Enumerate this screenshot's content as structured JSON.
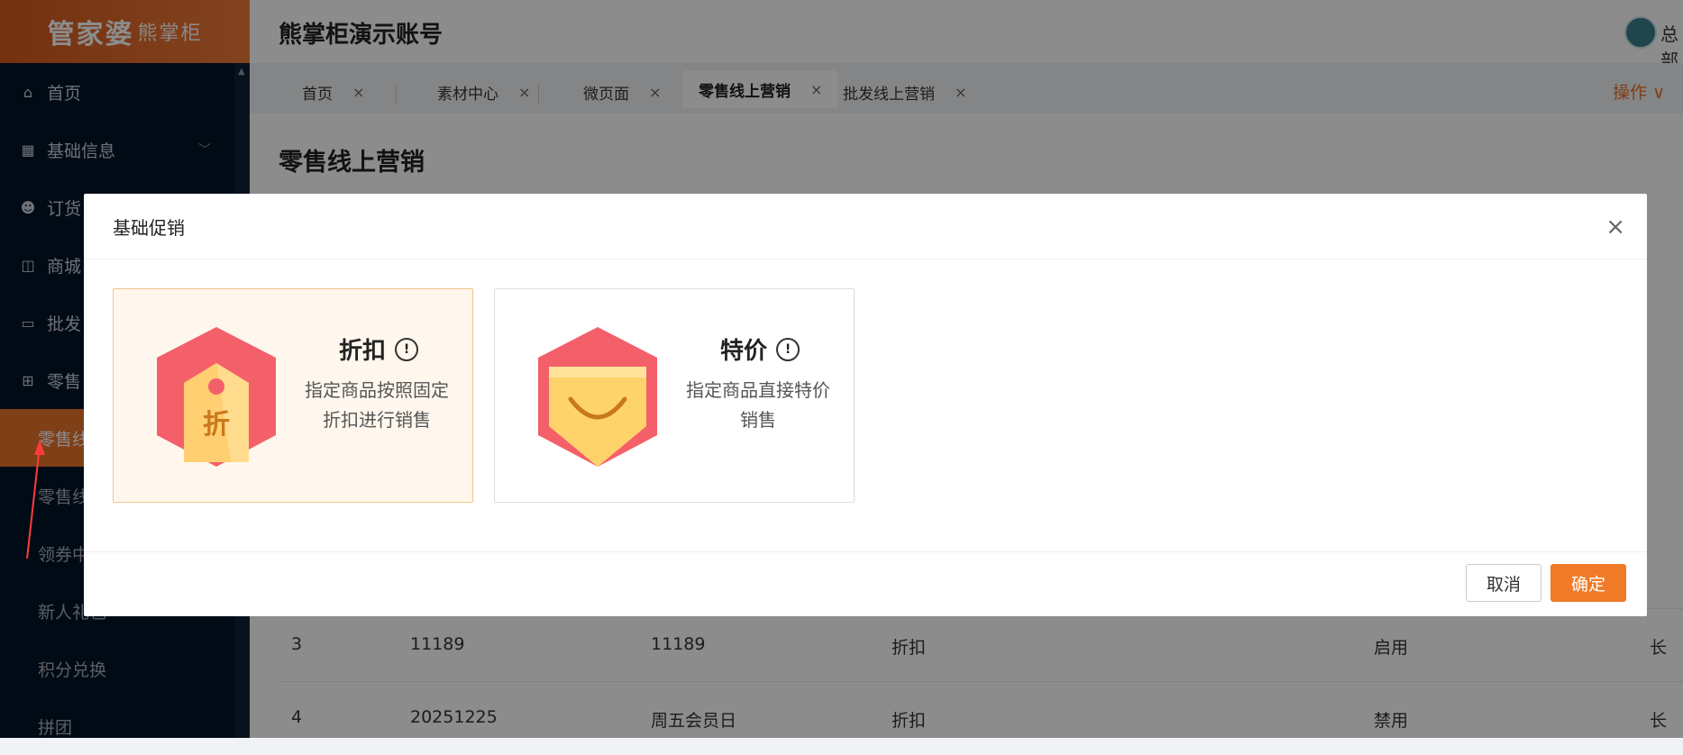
{
  "brand": {
    "logo": "管家婆",
    "logo_sub": "熊掌柜"
  },
  "header": {
    "account": "熊掌柜演示账号",
    "user": "总部"
  },
  "sidebar": {
    "items": [
      {
        "label": "首页",
        "icon": "home-icon"
      },
      {
        "label": "基础信息",
        "icon": "grid-icon"
      },
      {
        "label": "订货",
        "icon": "people-icon"
      },
      {
        "label": "商城",
        "icon": "bag-icon"
      },
      {
        "label": "批发",
        "icon": "card-icon"
      },
      {
        "label": "零售",
        "icon": "gift-icon"
      }
    ],
    "sub_items": [
      {
        "label": "零售线",
        "active": true
      },
      {
        "label": "零售线",
        "active": false
      },
      {
        "label": "领券中",
        "active": false
      },
      {
        "label": "新人礼包",
        "active": false
      },
      {
        "label": "积分兑换",
        "active": false
      },
      {
        "label": "拼团",
        "active": false
      }
    ]
  },
  "tabs": [
    {
      "label": "首页",
      "close": "×"
    },
    {
      "label": "素材中心",
      "close": "×"
    },
    {
      "label": "微页面",
      "close": "×"
    },
    {
      "label": "零售线上营销",
      "close": "×",
      "active": true
    },
    {
      "label": "批发线上营销",
      "close": "×"
    }
  ],
  "ops_label": "操作 ∨",
  "page": {
    "title": "零售线上营销"
  },
  "table": {
    "rows": [
      {
        "no": "3",
        "code": "11189",
        "name": "11189",
        "type": "折扣",
        "status": "启用",
        "tail": "长"
      },
      {
        "no": "4",
        "code": "20251225",
        "name": "周五会员日",
        "type": "折扣",
        "status": "禁用",
        "tail": "长"
      }
    ]
  },
  "modal": {
    "title": "基础促销",
    "close": "×",
    "cards": [
      {
        "title": "折扣",
        "info": "!",
        "desc": "指定商品按照固定折扣进行销售",
        "badge_text": "折",
        "selected": true
      },
      {
        "title": "特价",
        "info": "!",
        "desc": "指定商品直接特价销售",
        "selected": false
      }
    ],
    "cancel": "取消",
    "ok": "确定"
  },
  "colors": {
    "accent": "#f07a28",
    "sidebar": "#001529",
    "badge_red": "#f46069",
    "badge_yellow": "#ffd36b"
  }
}
